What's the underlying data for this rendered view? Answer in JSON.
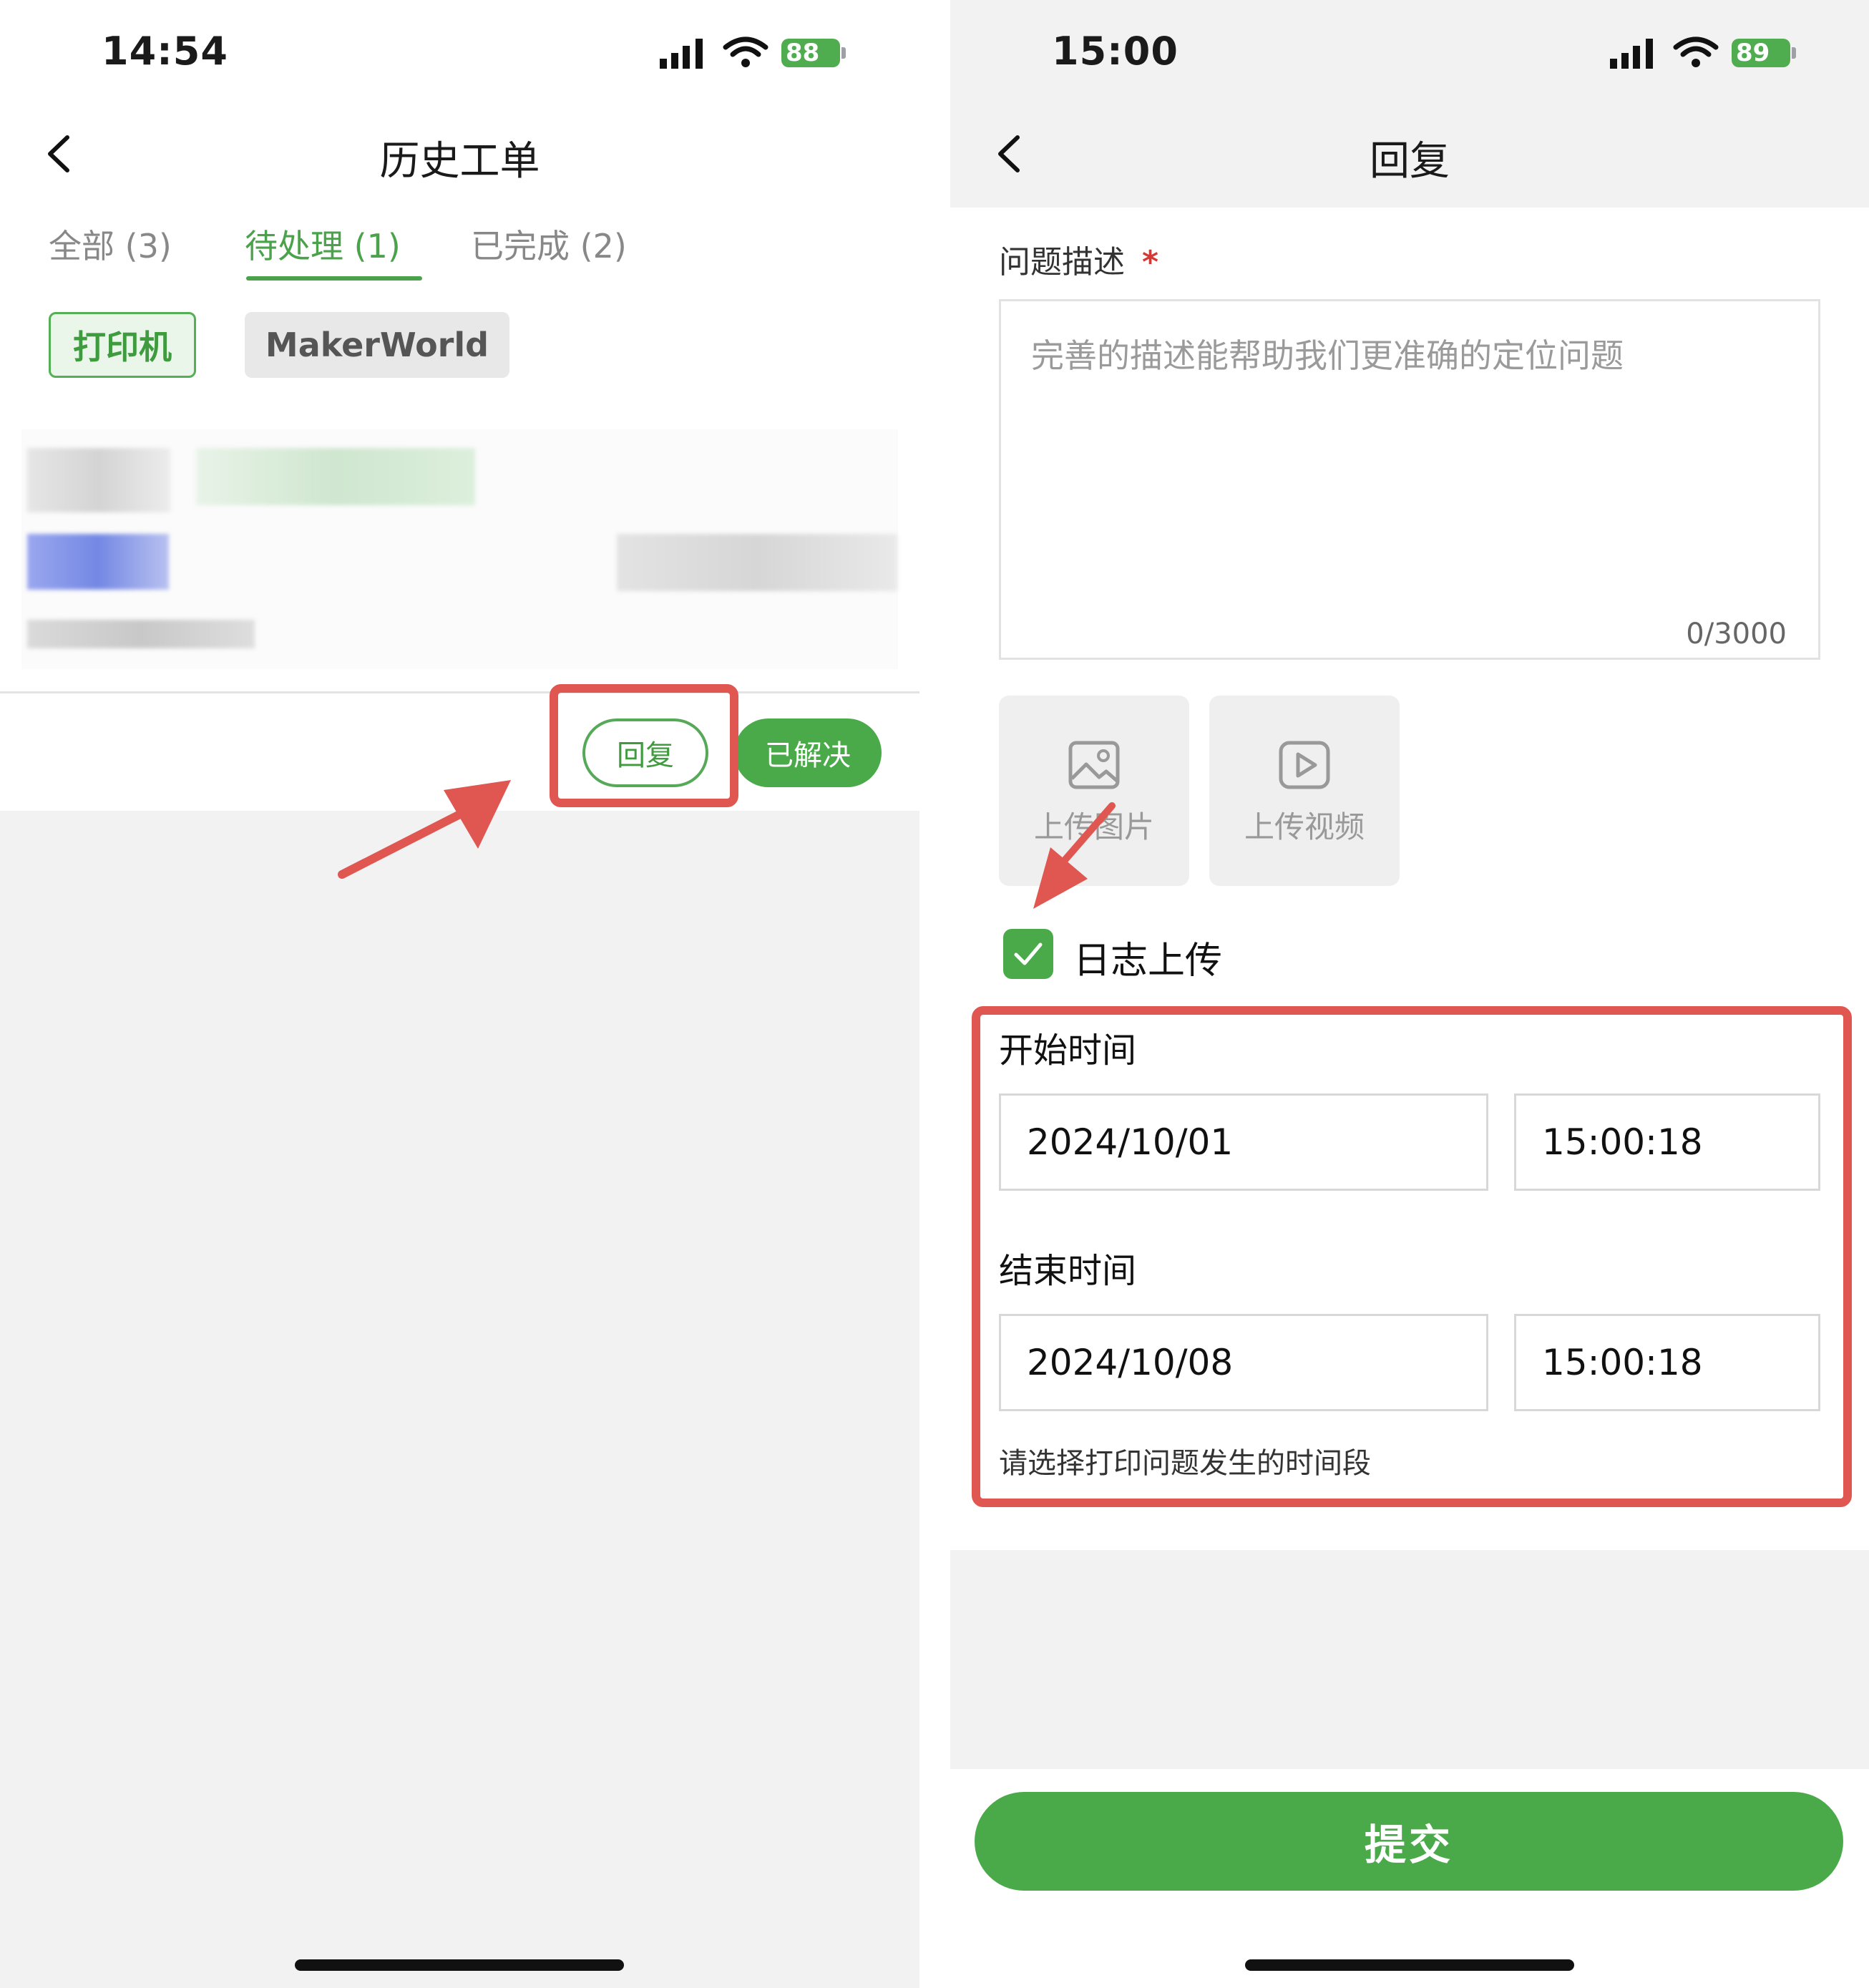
{
  "left": {
    "status": {
      "time": "14:54",
      "battery": "88"
    },
    "nav": {
      "title": "历史工单",
      "back": "<"
    },
    "tabs": [
      {
        "label": "全部 (3)"
      },
      {
        "label": "待处理 (1)"
      },
      {
        "label": "已完成 (2)"
      }
    ],
    "chips": [
      {
        "label": "打印机"
      },
      {
        "label": "MakerWorld"
      }
    ],
    "actions": {
      "reply": "回复",
      "resolved": "已解决"
    }
  },
  "right": {
    "status": {
      "time": "15:00",
      "battery": "89"
    },
    "nav": {
      "title": "回复",
      "back": "<"
    },
    "description": {
      "label": "问题描述",
      "required_mark": "*",
      "placeholder": "完善的描述能帮助我们更准确的定位问题",
      "counter": "0/3000"
    },
    "uploads": {
      "image": "上传图片",
      "video": "上传视频"
    },
    "log_upload": {
      "label": "日志上传",
      "checked": true
    },
    "start": {
      "title": "开始时间",
      "date": "2024/10/01",
      "time": "15:00:18"
    },
    "end": {
      "title": "结束时间",
      "date": "2024/10/08",
      "time": "15:00:18"
    },
    "hint": "请选择打印问题发生的时间段",
    "submit": "提交"
  },
  "colors": {
    "accent": "#4aaa4a",
    "annotation": "#e05650"
  }
}
